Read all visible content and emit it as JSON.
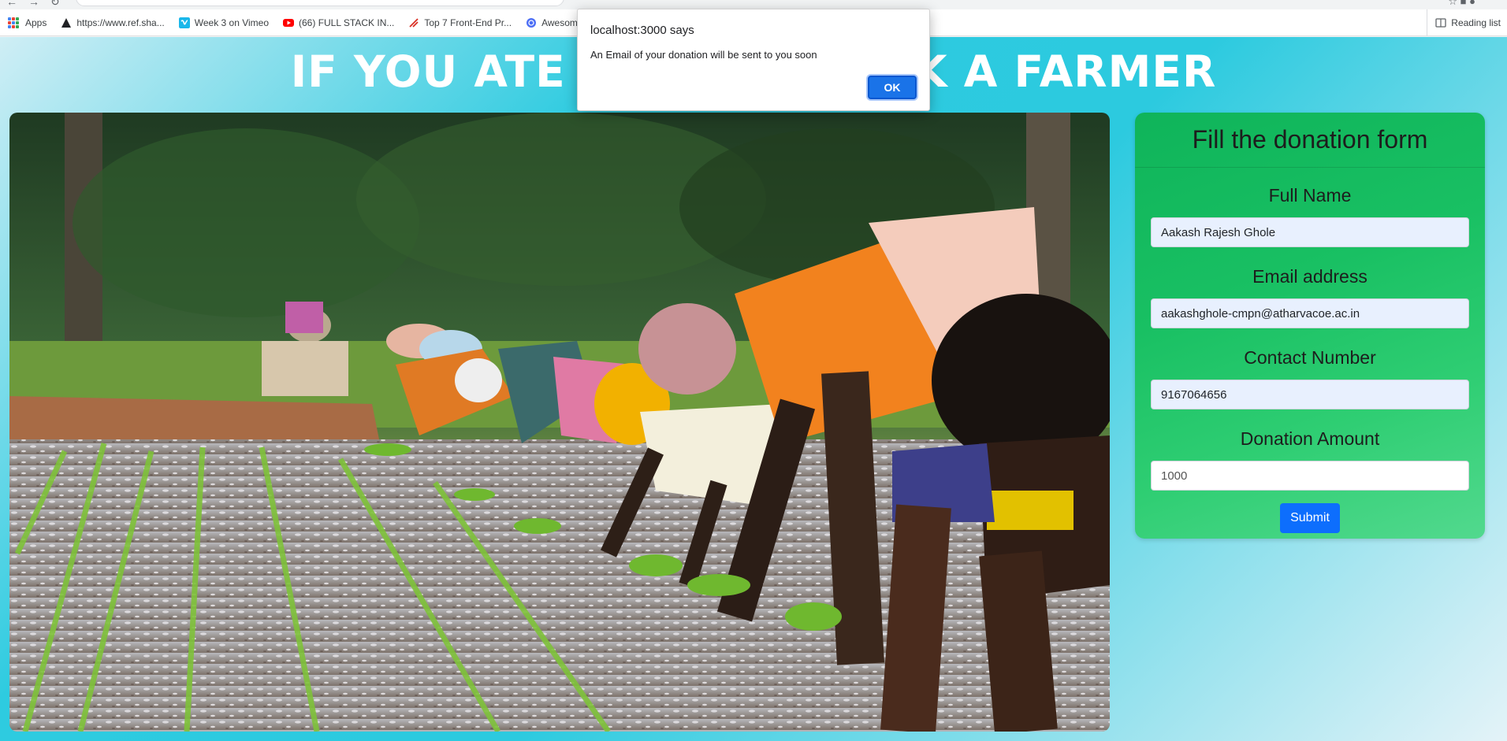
{
  "browser": {
    "bookmarks": [
      {
        "label": "Apps",
        "icon": "apps-grid-icon"
      },
      {
        "label": "https://www.ref.sha...",
        "icon": "bookmark-site-icon"
      },
      {
        "label": "Week 3 on Vimeo",
        "icon": "vimeo-icon"
      },
      {
        "label": "(66) FULL STACK IN...",
        "icon": "youtube-icon"
      },
      {
        "label": "Top 7 Front-End Pr...",
        "icon": "bookmark-site-icon"
      },
      {
        "label": "Awesom",
        "icon": "globe-icon"
      }
    ],
    "reading_list_label": "Reading list"
  },
  "page": {
    "hero_title": "IF YOU ATE TODAY, THANK A FARMER"
  },
  "form": {
    "title": "Fill the donation form",
    "full_name": {
      "label": "Full Name",
      "value": "Aakash Rajesh Ghole"
    },
    "email": {
      "label": "Email address",
      "value": "aakashghole-cmpn@atharvacoe.ac.in"
    },
    "contact": {
      "label": "Contact Number",
      "value": "9167064656"
    },
    "amount": {
      "label": "Donation Amount",
      "value": "1000"
    },
    "submit_label": "Submit"
  },
  "alert": {
    "title": "localhost:3000 says",
    "message": "An Email of your donation will be sent to you soon",
    "ok_label": "OK"
  },
  "colors": {
    "form_card": "#19c063",
    "submit_button": "#0d6efd",
    "alert_ok": "#1a73e8",
    "page_gradient": "#2ccadf"
  }
}
